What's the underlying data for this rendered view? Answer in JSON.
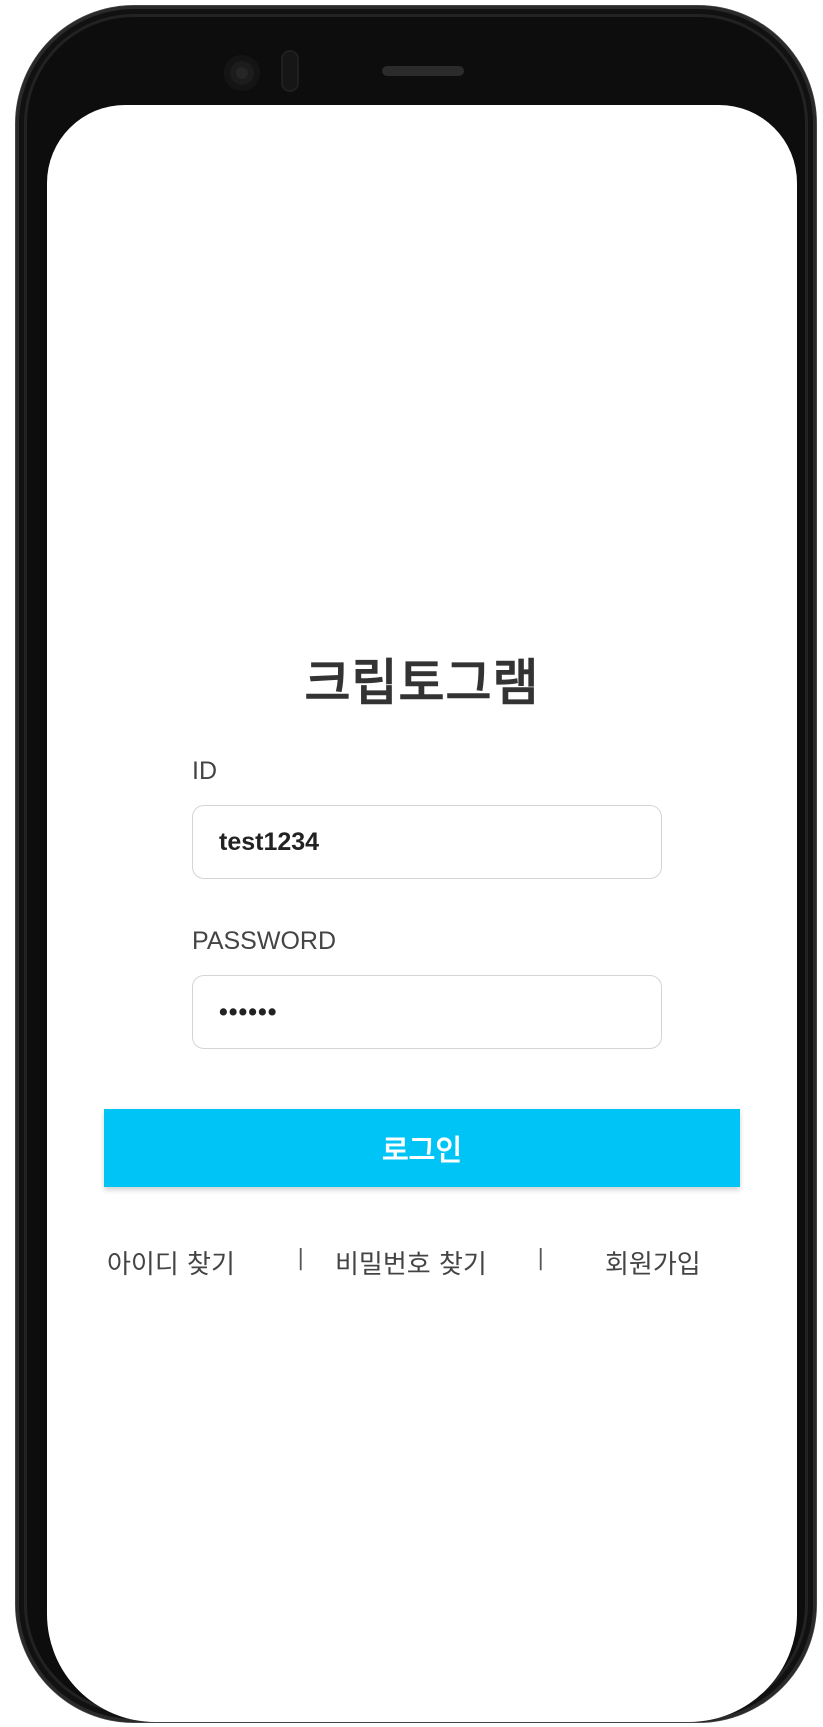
{
  "app": {
    "title": "크립토그램"
  },
  "login_form": {
    "id_label": "ID",
    "id_value": "test1234",
    "password_label": "PASSWORD",
    "password_value": "••••••",
    "login_button_label": "로그인"
  },
  "footer_links": {
    "find_id": "아이디 찾기",
    "separator": "|",
    "find_password": "비밀번호 찾기",
    "signup": "회원가입"
  },
  "colors": {
    "accent": "#00c4f5",
    "frame": "#0d0d0d",
    "screen": "#ffffff"
  },
  "icons": [
    "front-camera-icon",
    "proximity-sensor-icon",
    "earpiece-speaker-icon"
  ]
}
